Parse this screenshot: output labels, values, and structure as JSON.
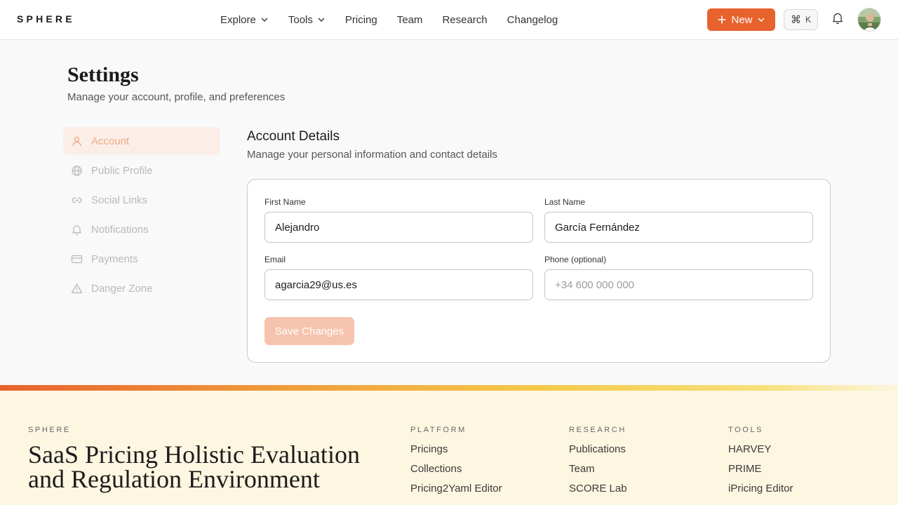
{
  "brand": "SPHERE",
  "nav": {
    "items": [
      {
        "label": "Explore",
        "dropdown": true
      },
      {
        "label": "Tools",
        "dropdown": true
      },
      {
        "label": "Pricing",
        "dropdown": false
      },
      {
        "label": "Team",
        "dropdown": false
      },
      {
        "label": "Research",
        "dropdown": false
      },
      {
        "label": "Changelog",
        "dropdown": false
      }
    ],
    "new_label": "New",
    "shortcut_symbol": "⌘",
    "shortcut_key": "K"
  },
  "page": {
    "title": "Settings",
    "subtitle": "Manage your account, profile, and preferences"
  },
  "sidebar": {
    "items": [
      {
        "label": "Account",
        "icon": "user-icon",
        "active": true
      },
      {
        "label": "Public Profile",
        "icon": "globe-icon",
        "active": false
      },
      {
        "label": "Social Links",
        "icon": "link-icon",
        "active": false
      },
      {
        "label": "Notifications",
        "icon": "bell-icon",
        "active": false
      },
      {
        "label": "Payments",
        "icon": "credit-card-icon",
        "active": false
      },
      {
        "label": "Danger Zone",
        "icon": "warning-icon",
        "active": false
      }
    ]
  },
  "section": {
    "title": "Account Details",
    "subtitle": "Manage your personal information and contact details"
  },
  "form": {
    "first_name": {
      "label": "First Name",
      "value": "Alejandro"
    },
    "last_name": {
      "label": "Last Name",
      "value": "García Fernández"
    },
    "email": {
      "label": "Email",
      "value": "agarcia29@us.es"
    },
    "phone": {
      "label": "Phone (optional)",
      "value": "",
      "placeholder": "+34 600 000 000"
    },
    "save_label": "Save Changes"
  },
  "footer": {
    "brand": "SPHERE",
    "tagline": "SaaS Pricing Holistic Evaluation and Regulation Environment",
    "columns": [
      {
        "title": "PLATFORM",
        "links": [
          "Pricings",
          "Collections",
          "Pricing2Yaml Editor"
        ]
      },
      {
        "title": "RESEARCH",
        "links": [
          "Publications",
          "Team",
          "SCORE Lab"
        ]
      },
      {
        "title": "TOOLS",
        "links": [
          "HARVEY",
          "PRIME",
          "iPricing Editor"
        ]
      }
    ]
  },
  "colors": {
    "accent": "#e8622d",
    "accent_soft": "#f6c3ae",
    "active_bg": "#fbeee7",
    "footer_bg": "#fdf6e1"
  }
}
